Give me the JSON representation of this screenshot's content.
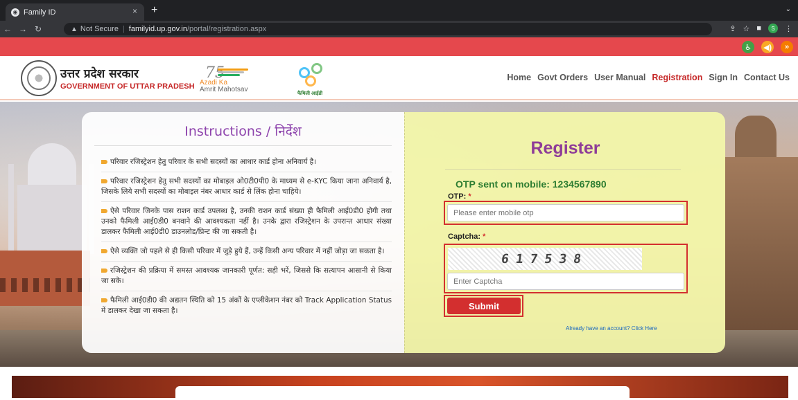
{
  "browser": {
    "tab_title": "Family ID",
    "tab_close": "×",
    "new_tab": "+",
    "url_warning": "Not Secure",
    "url_host": "familyid.up.gov.in",
    "url_path": "/portal/registration.aspx",
    "profile_initial": "S"
  },
  "header": {
    "gov_name_hi": "उत्तर प्रदेश सरकार",
    "gov_name_en": "GOVERNMENT OF UTTAR PRADESH",
    "azadi_line1": "Azadi Ka",
    "azadi_line2": "Amrit Mahotsav",
    "family_logo_label": "फैमिली आईडी",
    "menu": [
      "Home",
      "Govt Orders",
      "User Manual",
      "Registration",
      "Sign In",
      "Contact Us"
    ]
  },
  "instructions": {
    "title": "Instructions / निर्देश",
    "items": [
      "परिवार रजिस्ट्रेशन हेतु परिवार के सभी सदस्यों का आधार कार्ड होना अनिवार्य है।",
      "परिवार रजिस्ट्रेशन हेतु सभी सदस्यों का मोबाइल ओ0टी0पी0 के माध्यम से e-KYC किया जाना अनिवार्य है, जिसके लिये सभी सदस्यों का मोबाइल नंबर आधार कार्ड से लिंक होना चाहिये।",
      "ऐसे परिवार जिनके पास राशन कार्ड उपलब्ध है, उनकी राशन कार्ड संख्या ही फैमिली आई0डी0 होगी तथा उनको फैमिली आई0डी0 बनवाने की आवश्यकता नहीं है। उनके द्वारा रजिस्ट्रेशन के उपरान्त आधार संख्या डालकर फैमिली आई0डी0 डाउनलोड/प्रिन्ट की जा सकती है।",
      "ऐसे व्यक्ति जो पहले से ही किसी परिवार में जुड़े हुये हैं, उन्हें किसी अन्य परिवार में नहीं जोड़ा जा सकता है।",
      "रजिस्ट्रेशन की प्रक्रिया में समस्त आवश्यक जानकारी पूर्णत: सही भरें, जिससे कि सत्यापन आसानी से किया जा सके।",
      "फैमिली आई0डी0 की अद्यतन स्थिति को 15 अंकों के एप्लीकेशन नंबर को Track Application Status में डालकर देखा जा सकता है।"
    ]
  },
  "register": {
    "title": "Register",
    "otp_sent": "OTP sent on mobile: 1234567890",
    "otp_label": "OTP:",
    "required_mark": "*",
    "otp_placeholder": "Please enter mobile otp",
    "captcha_label": "Captcha:",
    "captcha_text": "617538",
    "captcha_placeholder": "Enter Captcha",
    "submit_label": "Submit",
    "already_link": "Already have an account? Click Here"
  },
  "colors": {
    "accent_red": "#d32f2f",
    "title_purple": "#8e3c98",
    "otp_green": "#2e7d32",
    "panel_yellow": "#f3f6aa"
  }
}
